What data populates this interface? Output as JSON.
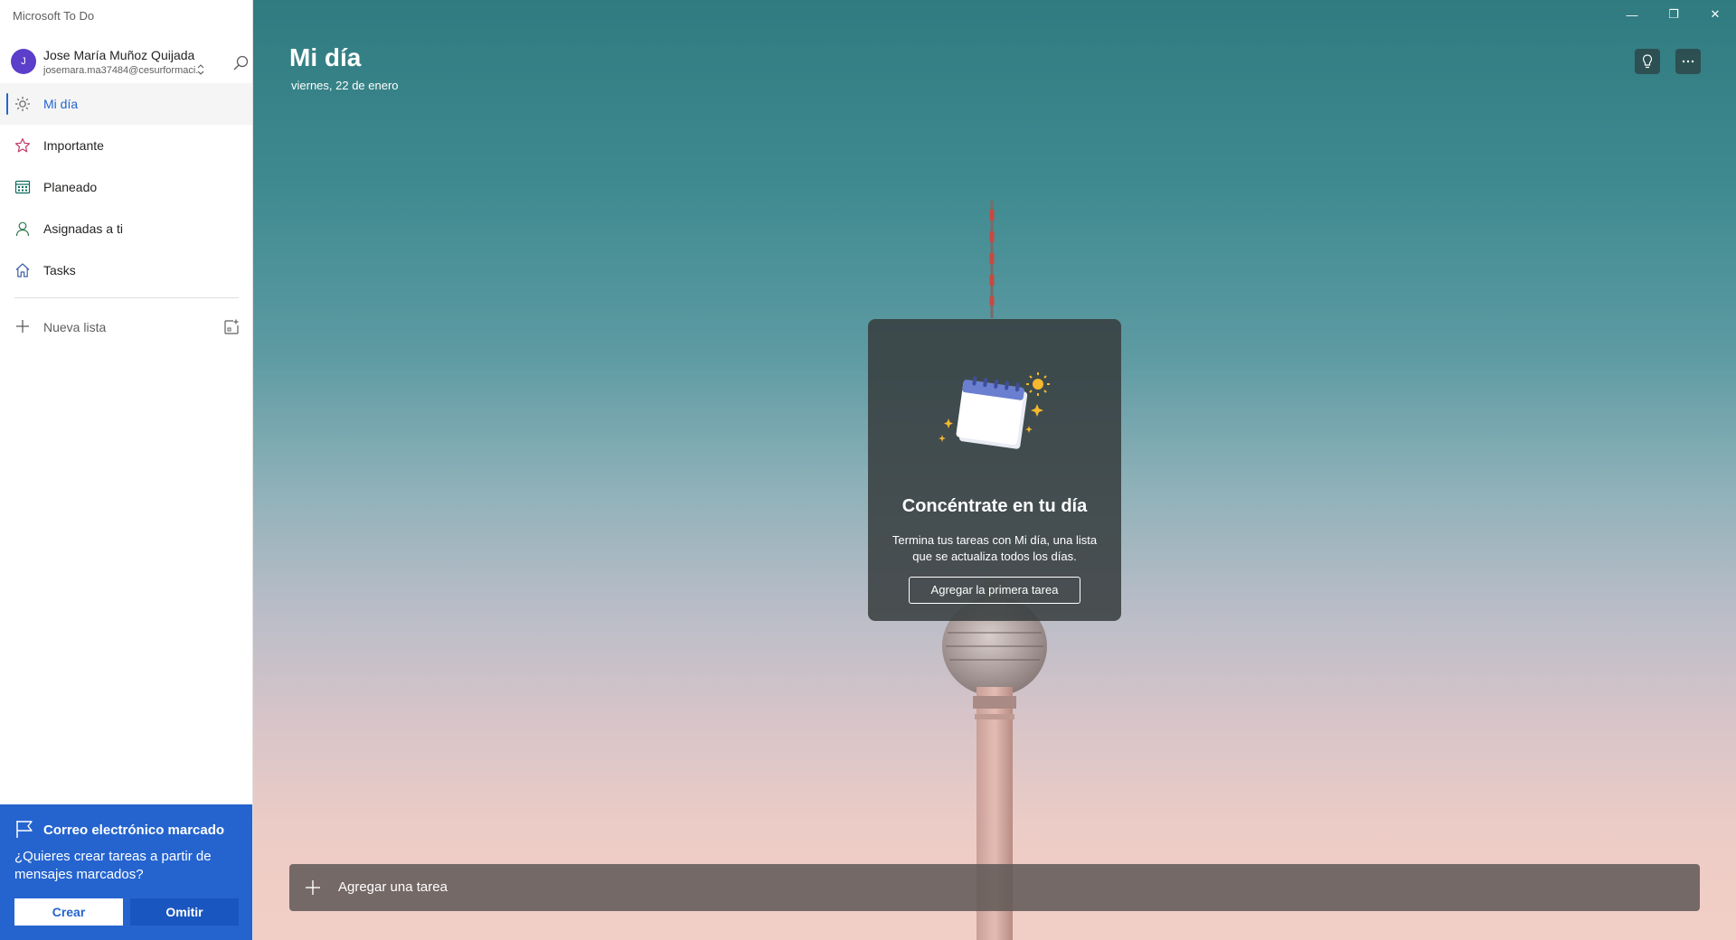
{
  "app": {
    "title": "Microsoft To Do"
  },
  "account": {
    "initial": "J",
    "name": "Jose María Muñoz Quijada",
    "email": "josemara.ma37484@cesurformaci...",
    "chevron": "⌃⌄"
  },
  "sidebar": {
    "items": [
      {
        "label": "Mi día",
        "icon": "sun-icon",
        "active": true
      },
      {
        "label": "Importante",
        "icon": "star-icon"
      },
      {
        "label": "Planeado",
        "icon": "calendar-icon"
      },
      {
        "label": "Asignadas a ti",
        "icon": "person-icon"
      },
      {
        "label": "Tasks",
        "icon": "home-icon"
      }
    ],
    "new_list_label": "Nueva lista"
  },
  "flag_banner": {
    "title": "Correo electrónico marcado",
    "body": "¿Quieres crear tareas a partir de mensajes marcados?",
    "create_label": "Crear",
    "skip_label": "Omitir"
  },
  "window": {
    "minimize": "—",
    "restore": "❐",
    "close": "✕"
  },
  "main": {
    "title": "Mi día",
    "date": "viernes, 22 de enero",
    "empty_state": {
      "title": "Concéntrate en tu día",
      "body": "Termina tus tareas con Mi día, una lista que se actualiza todos los días.",
      "button": "Agregar la primera tarea"
    },
    "add_task_placeholder": "Agregar una tarea"
  },
  "colors": {
    "accent": "#2564cf",
    "avatar": "#5b3ec9",
    "importante": "#c23b6a",
    "planeado": "#0f6b5e",
    "asignadas": "#2d7a4f"
  }
}
